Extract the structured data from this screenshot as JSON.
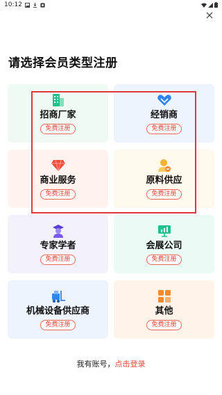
{
  "status_bar": {
    "time": "10:12"
  },
  "page": {
    "title": "请选择会员类型注册"
  },
  "cards": [
    {
      "label": "招商厂家",
      "button": "免费注册",
      "icon": "building-icon",
      "color": "#22c08a"
    },
    {
      "label": "经销商",
      "button": "免费注册",
      "icon": "handshake-icon",
      "color": "#2f86f0"
    },
    {
      "label": "商业服务",
      "button": "免费注册",
      "icon": "diamond-icon",
      "color": "#ef4d3c"
    },
    {
      "label": "原料供应",
      "button": "免费注册",
      "icon": "supplier-user-icon",
      "color": "#f3b331"
    },
    {
      "label": "专家学者",
      "button": "免费注册",
      "icon": "graduate-icon",
      "color": "#7a5af0"
    },
    {
      "label": "会展公司",
      "button": "免费注册",
      "icon": "presentation-board-icon",
      "color": "#1fc18d"
    },
    {
      "label": "机械设备供应商",
      "button": "免费注册",
      "icon": "forklift-icon",
      "color": "#2f86f0"
    },
    {
      "label": "其他",
      "button": "免费注册",
      "icon": "grid-squares-icon",
      "color": "#f28a2e"
    }
  ],
  "footer": {
    "text": "我有账号，",
    "link": "点击登录"
  },
  "colors": {
    "accent": "#e5483a",
    "highlight": "#e0383a"
  }
}
